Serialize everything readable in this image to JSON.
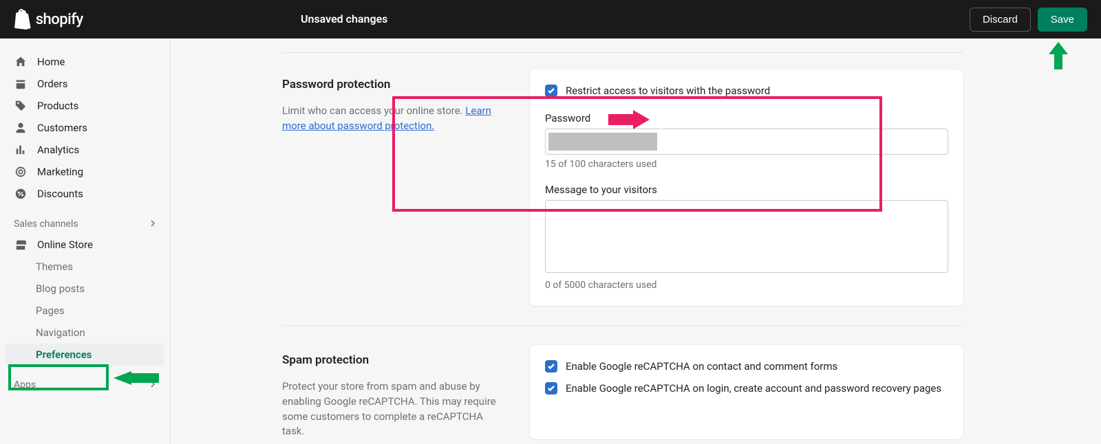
{
  "topbar": {
    "brand": "shopify",
    "title": "Unsaved changes",
    "discard_label": "Discard",
    "save_label": "Save"
  },
  "sidebar": {
    "items": [
      {
        "label": "Home"
      },
      {
        "label": "Orders"
      },
      {
        "label": "Products"
      },
      {
        "label": "Customers"
      },
      {
        "label": "Analytics"
      },
      {
        "label": "Marketing"
      },
      {
        "label": "Discounts"
      }
    ],
    "sales_channels_label": "Sales channels",
    "online_store": {
      "label": "Online Store",
      "sub": [
        {
          "label": "Themes"
        },
        {
          "label": "Blog posts"
        },
        {
          "label": "Pages"
        },
        {
          "label": "Navigation"
        },
        {
          "label": "Preferences"
        }
      ]
    },
    "apps_label": "Apps"
  },
  "password_section": {
    "title": "Password protection",
    "desc_1": "Limit who can access your online store. ",
    "link_text": "Learn more about password protection.",
    "checkbox_label": "Restrict access to visitors with the password",
    "password_label": "Password",
    "password_count": "15 of 100 characters used",
    "message_label": "Message to your visitors",
    "message_count": "0 of 5000 characters used"
  },
  "spam_section": {
    "title": "Spam protection",
    "desc": "Protect your store from spam and abuse by enabling Google reCAPTCHA. This may require some customers to complete a reCAPTCHA task.",
    "checkbox1_label": "Enable Google reCAPTCHA on contact and comment forms",
    "checkbox2_label": "Enable Google reCAPTCHA on login, create account and password recovery pages"
  }
}
